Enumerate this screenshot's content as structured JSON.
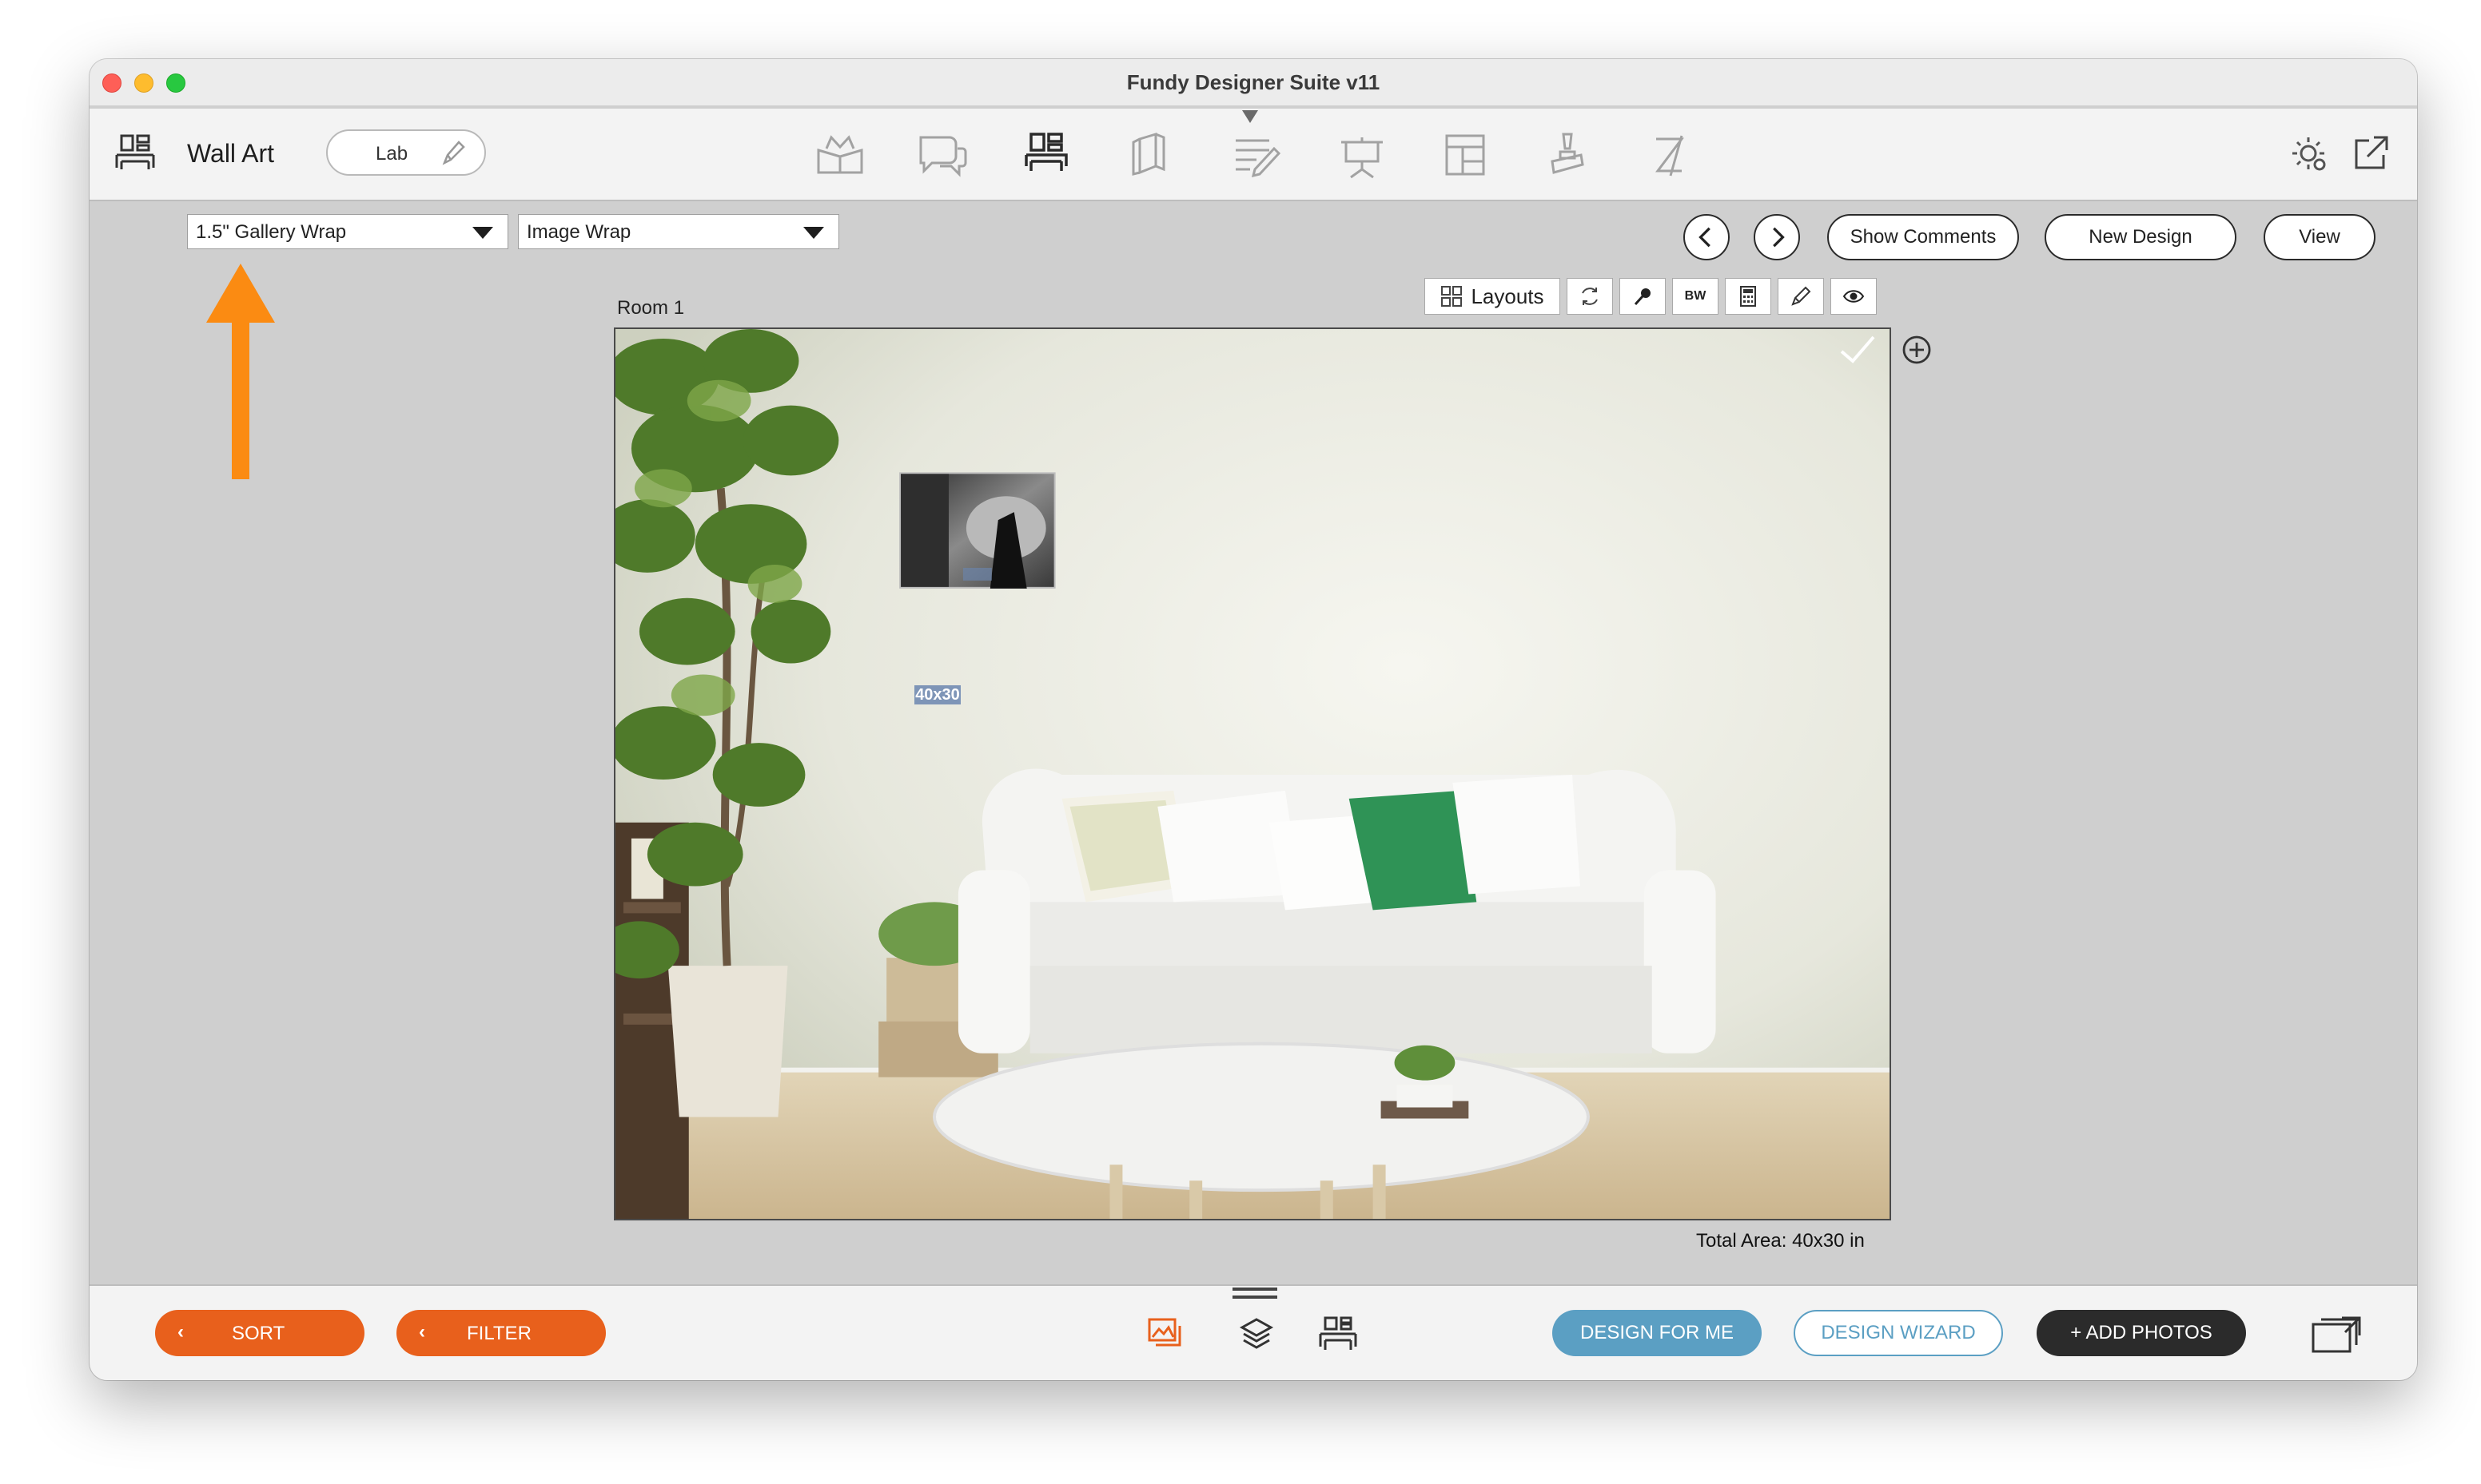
{
  "window": {
    "title": "Fundy Designer Suite v11"
  },
  "toolbar": {
    "section_title": "Wall Art",
    "lab_label": "Lab",
    "tools": [
      "album-icon",
      "comments-icon",
      "wall-art-icon",
      "cards-icon",
      "proofing-icon",
      "slideshow-icon",
      "layout-icon",
      "pen-tablet-icon",
      "blog-icon"
    ]
  },
  "controls": {
    "wrap_select": "1.5\" Gallery Wrap",
    "image_wrap_select": "Image Wrap",
    "show_comments": "Show Comments",
    "new_design": "New Design",
    "view": "View"
  },
  "room": {
    "label": "Room 1",
    "layouts_label": "Layouts",
    "bw_label": "BW",
    "print_size": "40x30",
    "total_area": "Total Area: 40x30 in"
  },
  "bottom": {
    "sort": "SORT",
    "filter": "FILTER",
    "design_for_me": "DESIGN FOR ME",
    "design_wizard": "DESIGN WIZARD",
    "add_photos": "+ ADD PHOTOS"
  },
  "colors": {
    "orange": "#e8601c",
    "design_for_me": "#5b9fc3",
    "design_wizard_border": "#5b9fc3",
    "add_photos": "#2b2b2b",
    "annotation_arrow": "#fb8b12"
  }
}
